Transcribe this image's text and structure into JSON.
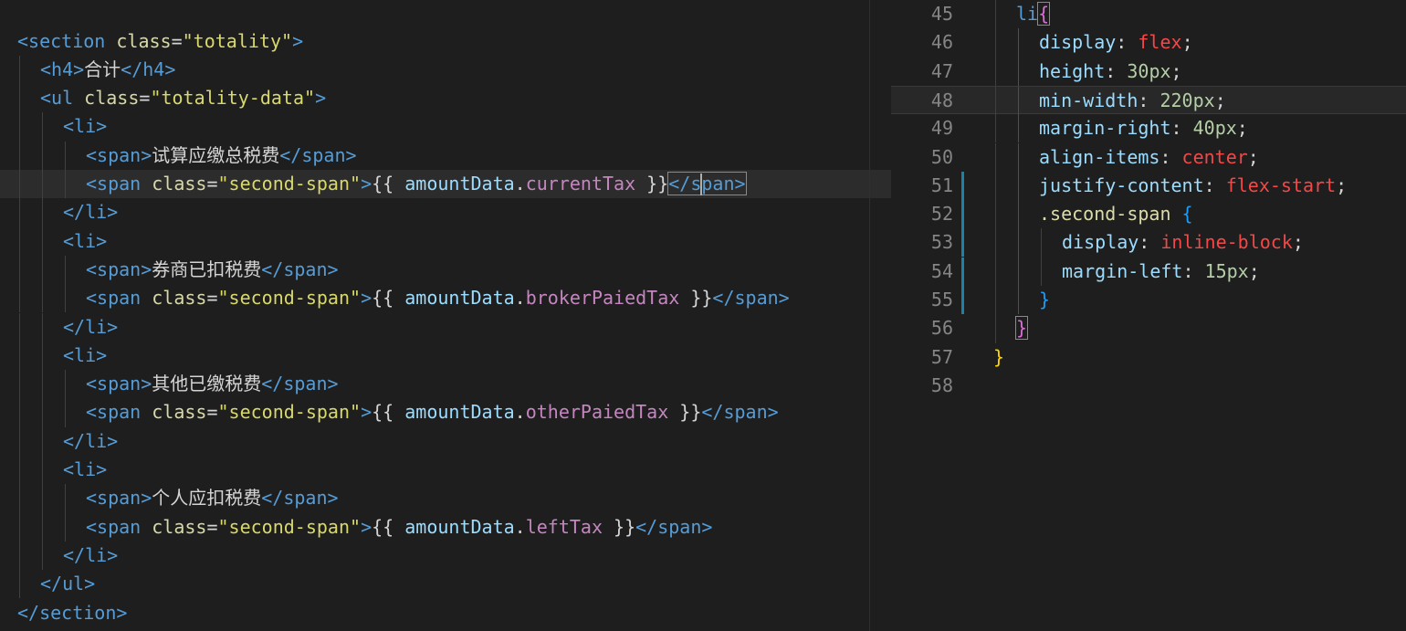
{
  "left_editor": {
    "lines": [
      {
        "indent": 0,
        "tokens": [
          [
            "tag",
            "<section "
          ],
          [
            "attr",
            "class"
          ],
          [
            "punct",
            "="
          ],
          [
            "str",
            "\"totality\""
          ],
          [
            "tag",
            ">"
          ]
        ]
      },
      {
        "indent": 1,
        "tokens": [
          [
            "tag",
            "<h4>"
          ],
          [
            "txt",
            "合计"
          ],
          [
            "tag",
            "</h4>"
          ]
        ]
      },
      {
        "indent": 1,
        "tokens": [
          [
            "tag",
            "<ul "
          ],
          [
            "attr",
            "class"
          ],
          [
            "punct",
            "="
          ],
          [
            "str",
            "\"totality-data\""
          ],
          [
            "tag",
            ">"
          ]
        ]
      },
      {
        "indent": 2,
        "tokens": [
          [
            "tag",
            "<li>"
          ]
        ]
      },
      {
        "indent": 3,
        "tokens": [
          [
            "tag",
            "<span>"
          ],
          [
            "txt",
            "试算应缴总税费"
          ],
          [
            "tag",
            "</span>"
          ]
        ]
      },
      {
        "indent": 3,
        "tokens": [
          [
            "tag",
            "<span "
          ],
          [
            "attr",
            "class"
          ],
          [
            "punct",
            "="
          ],
          [
            "str",
            "\"second-span\""
          ],
          [
            "tag",
            ">"
          ],
          [
            "tpl",
            "{{ "
          ],
          [
            "var",
            "amountData"
          ],
          [
            "punct",
            "."
          ],
          [
            "prop",
            "currentTax"
          ],
          [
            "tpl",
            " }}"
          ],
          [
            "tag",
            "</span>"
          ]
        ]
      },
      {
        "indent": 2,
        "tokens": [
          [
            "tag",
            "</li>"
          ]
        ]
      },
      {
        "indent": 2,
        "tokens": [
          [
            "tag",
            "<li>"
          ]
        ]
      },
      {
        "indent": 3,
        "tokens": [
          [
            "tag",
            "<span>"
          ],
          [
            "txt",
            "券商已扣税费"
          ],
          [
            "tag",
            "</span>"
          ]
        ]
      },
      {
        "indent": 3,
        "tokens": [
          [
            "tag",
            "<span "
          ],
          [
            "attr",
            "class"
          ],
          [
            "punct",
            "="
          ],
          [
            "str",
            "\"second-span\""
          ],
          [
            "tag",
            ">"
          ],
          [
            "tpl",
            "{{ "
          ],
          [
            "var",
            "amountData"
          ],
          [
            "punct",
            "."
          ],
          [
            "prop",
            "brokerPaiedTax"
          ],
          [
            "tpl",
            " }}"
          ],
          [
            "tag",
            "</span>"
          ]
        ]
      },
      {
        "indent": 2,
        "tokens": [
          [
            "tag",
            "</li>"
          ]
        ]
      },
      {
        "indent": 2,
        "tokens": [
          [
            "tag",
            "<li>"
          ]
        ]
      },
      {
        "indent": 3,
        "tokens": [
          [
            "tag",
            "<span>"
          ],
          [
            "txt",
            "其他已缴税费"
          ],
          [
            "tag",
            "</span>"
          ]
        ]
      },
      {
        "indent": 3,
        "tokens": [
          [
            "tag",
            "<span "
          ],
          [
            "attr",
            "class"
          ],
          [
            "punct",
            "="
          ],
          [
            "str",
            "\"second-span\""
          ],
          [
            "tag",
            ">"
          ],
          [
            "tpl",
            "{{ "
          ],
          [
            "var",
            "amountData"
          ],
          [
            "punct",
            "."
          ],
          [
            "prop",
            "otherPaiedTax"
          ],
          [
            "tpl",
            " }}"
          ],
          [
            "tag",
            "</span>"
          ]
        ]
      },
      {
        "indent": 2,
        "tokens": [
          [
            "tag",
            "</li>"
          ]
        ]
      },
      {
        "indent": 2,
        "tokens": [
          [
            "tag",
            "<li>"
          ]
        ]
      },
      {
        "indent": 3,
        "tokens": [
          [
            "tag",
            "<span>"
          ],
          [
            "txt",
            "个人应扣税费"
          ],
          [
            "tag",
            "</span>"
          ]
        ]
      },
      {
        "indent": 3,
        "tokens": [
          [
            "tag",
            "<span "
          ],
          [
            "attr",
            "class"
          ],
          [
            "punct",
            "="
          ],
          [
            "str",
            "\"second-span\""
          ],
          [
            "tag",
            ">"
          ],
          [
            "tpl",
            "{{ "
          ],
          [
            "var",
            "amountData"
          ],
          [
            "punct",
            "."
          ],
          [
            "prop",
            "leftTax"
          ],
          [
            "tpl",
            " }}"
          ],
          [
            "tag",
            "</span>"
          ]
        ]
      },
      {
        "indent": 2,
        "tokens": [
          [
            "tag",
            "</li>"
          ]
        ]
      },
      {
        "indent": 1,
        "tokens": [
          [
            "tag",
            "</ul>"
          ]
        ]
      },
      {
        "indent": 0,
        "tokens": [
          [
            "tag",
            "</section>"
          ]
        ]
      }
    ]
  },
  "right_editor": {
    "lines": [
      {
        "num": "45",
        "indent": 1,
        "tokens": [
          [
            "sel",
            "li"
          ],
          [
            "br-p",
            "{"
          ]
        ]
      },
      {
        "num": "46",
        "indent": 2,
        "tokens": [
          [
            "cssprop",
            "display"
          ],
          [
            "punct",
            ": "
          ],
          [
            "kw",
            "flex"
          ],
          [
            "punct",
            ";"
          ]
        ]
      },
      {
        "num": "47",
        "indent": 2,
        "tokens": [
          [
            "cssprop",
            "height"
          ],
          [
            "punct",
            ": "
          ],
          [
            "num",
            "30"
          ],
          [
            "unit",
            "px"
          ],
          [
            "punct",
            ";"
          ]
        ]
      },
      {
        "num": "48",
        "indent": 2,
        "tokens": [
          [
            "cssprop",
            "min-width"
          ],
          [
            "punct",
            ": "
          ],
          [
            "num",
            "220"
          ],
          [
            "unit",
            "px"
          ],
          [
            "punct",
            ";"
          ]
        ]
      },
      {
        "num": "49",
        "indent": 2,
        "tokens": [
          [
            "cssprop",
            "margin-right"
          ],
          [
            "punct",
            ": "
          ],
          [
            "num",
            "40"
          ],
          [
            "unit",
            "px"
          ],
          [
            "punct",
            ";"
          ]
        ]
      },
      {
        "num": "50",
        "indent": 2,
        "tokens": [
          [
            "cssprop",
            "align-items"
          ],
          [
            "punct",
            ": "
          ],
          [
            "kw",
            "center"
          ],
          [
            "punct",
            ";"
          ]
        ]
      },
      {
        "num": "51",
        "indent": 2,
        "tokens": [
          [
            "cssprop",
            "justify-content"
          ],
          [
            "punct",
            ": "
          ],
          [
            "kw",
            "flex-start"
          ],
          [
            "punct",
            ";"
          ]
        ]
      },
      {
        "num": "52",
        "indent": 2,
        "tokens": [
          [
            "cls",
            ".second-span"
          ],
          [
            "punct",
            " "
          ],
          [
            "br-b",
            "{"
          ]
        ]
      },
      {
        "num": "53",
        "indent": 3,
        "tokens": [
          [
            "cssprop",
            "display"
          ],
          [
            "punct",
            ": "
          ],
          [
            "kw",
            "inline-block"
          ],
          [
            "punct",
            ";"
          ]
        ]
      },
      {
        "num": "54",
        "indent": 3,
        "tokens": [
          [
            "cssprop",
            "margin-left"
          ],
          [
            "punct",
            ": "
          ],
          [
            "num",
            "15"
          ],
          [
            "unit",
            "px"
          ],
          [
            "punct",
            ";"
          ]
        ]
      },
      {
        "num": "55",
        "indent": 2,
        "tokens": [
          [
            "br-b",
            "}"
          ]
        ]
      },
      {
        "num": "56",
        "indent": 1,
        "tokens": [
          [
            "br-p",
            "}"
          ]
        ]
      },
      {
        "num": "57",
        "indent": 0,
        "tokens": [
          [
            "br-y",
            "}"
          ]
        ]
      },
      {
        "num": "58",
        "indent": 0,
        "tokens": []
      }
    ]
  },
  "colors": {
    "background": "#1e1e1e",
    "tag": "#569cd6",
    "attribute": "#d8d8a8",
    "string": "#d9d96a",
    "css_value": "#f44747",
    "number": "#b5cea8",
    "line_number": "#858585",
    "modified_gutter": "#1b81a8"
  }
}
